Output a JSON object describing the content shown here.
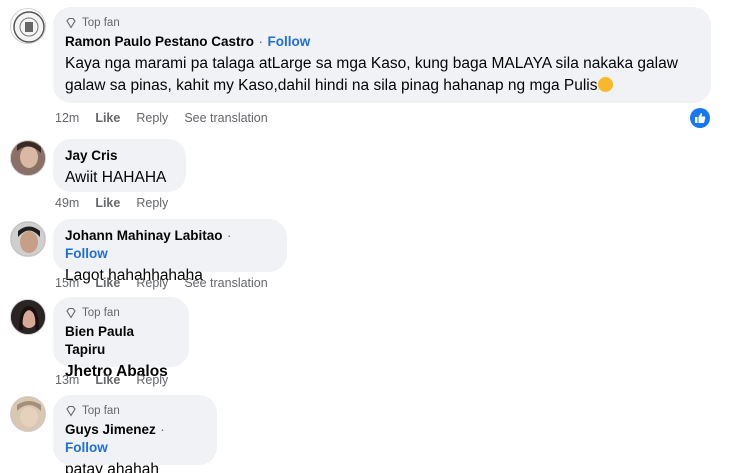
{
  "comments": [
    {
      "badge": "Top fan",
      "author": "Ramon Paulo Pestano Castro",
      "follow": "Follow",
      "lines": [
        "Kaya nga marami pa talaga atLarge sa mga Kaso, kung baga MALAYA sila nakaka galaw",
        "galaw sa pinas, kahit my Kaso,dahil hindi na sila pinag hahanap ng mga Pulis"
      ],
      "time": "12m",
      "like": "Like",
      "reply": "Reply",
      "translate": "See translation"
    },
    {
      "author": "Jay Cris",
      "lines": [
        "Awiit HAHAHA"
      ],
      "time": "49m",
      "like": "Like",
      "reply": "Reply"
    },
    {
      "author": "Johann Mahinay Labitao",
      "follow": "Follow",
      "lines": [
        "Lagot hahahhahaha"
      ],
      "time": "15m",
      "like": "Like",
      "reply": "Reply",
      "translate": "See translation"
    },
    {
      "badge": "Top fan",
      "author": "Bien Paula Tapiru",
      "lines": [
        "Jhetro Abalos"
      ],
      "time": "13m",
      "like": "Like",
      "reply": "Reply"
    },
    {
      "badge": "Top fan",
      "author": "Guys Jimenez",
      "follow": "Follow",
      "lines": [
        "patay ahahah"
      ]
    }
  ],
  "separator": "·",
  "icons": {
    "badge": "diamond-icon",
    "reaction": "like-reaction-icon",
    "emoji": "grinning-sweat-emoji"
  },
  "colors": {
    "bubble": "#f0f2f5",
    "follow": "#216fdb",
    "meta": "#65676b",
    "reaction": "#1877f2"
  }
}
